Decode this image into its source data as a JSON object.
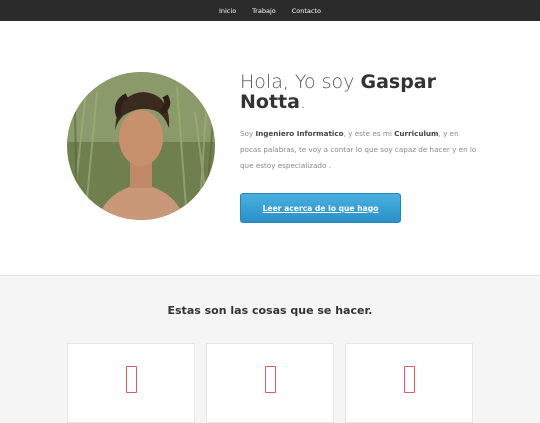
{
  "nav": {
    "items": [
      "Inicio",
      "Trabajo",
      "Contacto"
    ]
  },
  "hero": {
    "greeting": "Hola, Yo soy ",
    "name": "Gaspar Notta",
    "period": ".",
    "intro_pre": "Soy ",
    "intro_role": "Ingeniero Informatico",
    "intro_mid": ", y este es mi ",
    "intro_cv": "Curriculum",
    "intro_post": ", y en pocas palabras, te voy a contar lo que soy capaz de hacer y en lo que estoy especializado .",
    "cta_label": "Leer acerca de lo que hago"
  },
  "skills": {
    "title": "Estas son las cosas que se hacer.",
    "cards": [
      {
        "icon": "code-icon"
      },
      {
        "icon": "code-icon"
      },
      {
        "icon": "code-icon"
      }
    ]
  },
  "colors": {
    "nav_bg": "#2b2b2b",
    "cta_bg": "#3a9fd4",
    "icon_accent": "#e05a67"
  }
}
